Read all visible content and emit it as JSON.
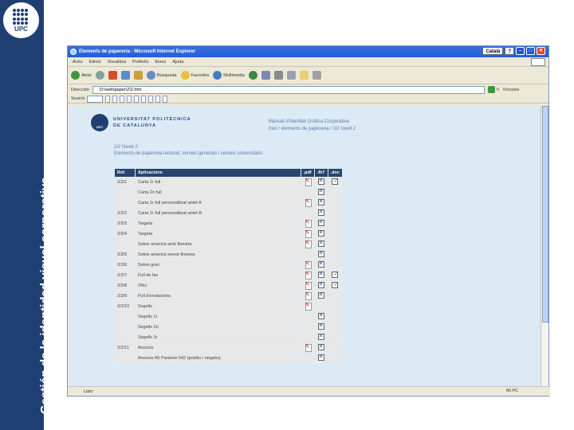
{
  "slide": {
    "side_title": "Gestión de la identidad visual corporativa",
    "logo_text": "UPC"
  },
  "browser": {
    "title": "Elements de papereria - Microsoft Internet Explorer",
    "lang": "Català",
    "help": "?",
    "menu": [
      "Arxiu",
      "Edició",
      "Visualitza",
      "Preferits",
      "Eines",
      "Ajuda"
    ],
    "toolbar": {
      "back": "Atrás",
      "search": "Búsqueda",
      "favorites": "Favoritos",
      "multimedia": "Multimedia"
    },
    "address_label": "Dirección",
    "address_value": "D:\\web\\paper\\2\\2.htm",
    "go_label": "Ir",
    "links_label": "Vínculos",
    "search_label": "Search",
    "link_buttons": [
      "",
      "",
      "",
      "",
      "",
      "",
      "",
      "",
      ""
    ],
    "status_left": "Listo",
    "status_zone": "Mi PC"
  },
  "page": {
    "upc_line1": "UNIVERSITAT POLITÈCNICA",
    "upc_line2": "DE CATALUNYA",
    "upc_logo": "UPC",
    "manual_line1": "Manual d'Identitat Gràfica Corporativa",
    "manual_line2": "Inici / elements de papereria / 2/2 nivell 2",
    "section_line1": "2/2 Nivell 2",
    "section_line2": "Elements de papereria rectoral, serveis generals i serveis universitaris",
    "table": {
      "headers": [
        "Ref.",
        "Aplicacions",
        ".pdf",
        ".fh7",
        ".doc"
      ],
      "rows": [
        {
          "ref": "2/2/1",
          "app": "Carta 1r full",
          "pdf": true,
          "fh": true,
          "doc": true
        },
        {
          "ref": "",
          "app": "Carta 2n full",
          "pdf": false,
          "fh": true,
          "doc": false
        },
        {
          "ref": "",
          "app": "Carta 1r full personalitzat antet A",
          "pdf": true,
          "fh": true,
          "doc": false
        },
        {
          "ref": "2/2/2",
          "app": "Carta 1r full personalitzat antet B",
          "pdf": false,
          "fh": true,
          "doc": false
        },
        {
          "ref": "2/2/3",
          "app": "Targeta",
          "pdf": true,
          "fh": true,
          "doc": false
        },
        {
          "ref": "2/2/4",
          "app": "Targeta",
          "pdf": true,
          "fh": true,
          "doc": false
        },
        {
          "ref": "",
          "app": "Sobre americà amb finestra",
          "pdf": true,
          "fh": true,
          "doc": false
        },
        {
          "ref": "2/2/5",
          "app": "Sobre americà sense finestra",
          "pdf": false,
          "fh": true,
          "doc": false
        },
        {
          "ref": "2/2/6",
          "app": "Sobre gran",
          "pdf": true,
          "fh": true,
          "doc": false
        },
        {
          "ref": "2/2/7",
          "app": "Full de fax",
          "pdf": true,
          "fh": true,
          "doc": true
        },
        {
          "ref": "2/2/8",
          "app": "Ofici",
          "pdf": true,
          "fh": true,
          "doc": true
        },
        {
          "ref": "2/2/9",
          "app": "Full d'enotacions",
          "pdf": true,
          "fh": true,
          "doc": false
        },
        {
          "ref": "2/2/10",
          "app": "Segells",
          "pdf": true,
          "fh": false,
          "doc": false
        },
        {
          "ref": "",
          "app": "Segells 1r",
          "pdf": false,
          "fh": true,
          "doc": false
        },
        {
          "ref": "",
          "app": "Segells 2n",
          "pdf": false,
          "fh": true,
          "doc": false
        },
        {
          "ref": "",
          "app": "Segells 3r",
          "pdf": false,
          "fh": true,
          "doc": false
        },
        {
          "ref": "2/2/11",
          "app": "Anuncis",
          "pdf": true,
          "fh": true,
          "doc": false
        },
        {
          "ref": "",
          "app": "Anuncis A5 Pantone 542 (positiu i negatiu)",
          "pdf": false,
          "fh": true,
          "doc": false
        }
      ]
    }
  }
}
